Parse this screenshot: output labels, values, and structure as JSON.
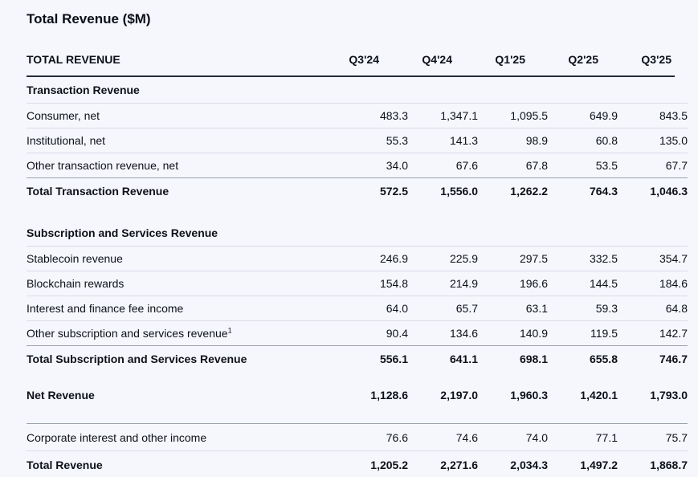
{
  "page": {
    "background_color": "#f5f7fd",
    "text_color": "#0d1117",
    "dark_rule_color": "#262b36",
    "medium_rule_color": "#9aa0ac",
    "light_rule_color": "#d8dce5"
  },
  "title": "Total Revenue ($M)",
  "table": {
    "header": {
      "label": "TOTAL REVENUE",
      "columns": [
        "Q3'24",
        "Q4'24",
        "Q1'25",
        "Q2'25",
        "Q3'25"
      ]
    },
    "rows": [
      {
        "type": "section",
        "label": "Transaction Revenue"
      },
      {
        "type": "data",
        "label": "Consumer, net",
        "values": [
          "483.3",
          "1,347.1",
          "1,095.5",
          "649.9",
          "843.5"
        ]
      },
      {
        "type": "data",
        "label": "Institutional, net",
        "values": [
          "55.3",
          "141.3",
          "98.9",
          "60.8",
          "135.0"
        ]
      },
      {
        "type": "data",
        "label": "Other transaction revenue, net",
        "values": [
          "34.0",
          "67.6",
          "67.8",
          "53.5",
          "67.7"
        ]
      },
      {
        "type": "total",
        "label": "Total Transaction Revenue",
        "values": [
          "572.5",
          "1,556.0",
          "1,262.2",
          "764.3",
          "1,046.3"
        ]
      },
      {
        "type": "section",
        "label": "Subscription and Services Revenue"
      },
      {
        "type": "data",
        "label": "Stablecoin revenue",
        "values": [
          "246.9",
          "225.9",
          "297.5",
          "332.5",
          "354.7"
        ]
      },
      {
        "type": "data",
        "label": "Blockchain rewards",
        "values": [
          "154.8",
          "214.9",
          "196.6",
          "144.5",
          "184.6"
        ]
      },
      {
        "type": "data",
        "label": "Interest and finance fee income",
        "values": [
          "64.0",
          "65.7",
          "63.1",
          "59.3",
          "64.8"
        ]
      },
      {
        "type": "data",
        "label": "Other subscription and services revenue",
        "sup": "1",
        "values": [
          "90.4",
          "134.6",
          "140.9",
          "119.5",
          "142.7"
        ]
      },
      {
        "type": "total",
        "label": "Total Subscription and Services Revenue",
        "values": [
          "556.1",
          "641.1",
          "698.1",
          "655.8",
          "746.7"
        ]
      },
      {
        "type": "total",
        "label": "Net Revenue",
        "values": [
          "1,128.6",
          "2,197.0",
          "1,960.3",
          "1,420.1",
          "1,793.0"
        ]
      },
      {
        "type": "data",
        "label": "Corporate interest and other income",
        "values": [
          "76.6",
          "74.6",
          "74.0",
          "77.1",
          "75.7"
        ]
      },
      {
        "type": "total",
        "label": "Total Revenue",
        "values": [
          "1,205.2",
          "2,271.6",
          "2,034.3",
          "1,497.2",
          "1,868.7"
        ]
      }
    ]
  },
  "chart_data": {
    "type": "table",
    "title": "Total Revenue ($M)",
    "categories": [
      "Q3'24",
      "Q4'24",
      "Q1'25",
      "Q2'25",
      "Q3'25"
    ],
    "series": [
      {
        "name": "Consumer, net",
        "section": "Transaction Revenue",
        "values": [
          483.3,
          1347.1,
          1095.5,
          649.9,
          843.5
        ]
      },
      {
        "name": "Institutional, net",
        "section": "Transaction Revenue",
        "values": [
          55.3,
          141.3,
          98.9,
          60.8,
          135.0
        ]
      },
      {
        "name": "Other transaction revenue, net",
        "section": "Transaction Revenue",
        "values": [
          34.0,
          67.6,
          67.8,
          53.5,
          67.7
        ]
      },
      {
        "name": "Total Transaction Revenue",
        "section": "Transaction Revenue",
        "values": [
          572.5,
          1556.0,
          1262.2,
          764.3,
          1046.3
        ]
      },
      {
        "name": "Stablecoin revenue",
        "section": "Subscription and Services Revenue",
        "values": [
          246.9,
          225.9,
          297.5,
          332.5,
          354.7
        ]
      },
      {
        "name": "Blockchain rewards",
        "section": "Subscription and Services Revenue",
        "values": [
          154.8,
          214.9,
          196.6,
          144.5,
          184.6
        ]
      },
      {
        "name": "Interest and finance fee income",
        "section": "Subscription and Services Revenue",
        "values": [
          64.0,
          65.7,
          63.1,
          59.3,
          64.8
        ]
      },
      {
        "name": "Other subscription and services revenue",
        "section": "Subscription and Services Revenue",
        "values": [
          90.4,
          134.6,
          140.9,
          119.5,
          142.7
        ]
      },
      {
        "name": "Total Subscription and Services Revenue",
        "section": "Subscription and Services Revenue",
        "values": [
          556.1,
          641.1,
          698.1,
          655.8,
          746.7
        ]
      },
      {
        "name": "Net Revenue",
        "values": [
          1128.6,
          2197.0,
          1960.3,
          1420.1,
          1793.0
        ]
      },
      {
        "name": "Corporate interest and other income",
        "values": [
          76.6,
          74.6,
          74.0,
          77.1,
          75.7
        ]
      },
      {
        "name": "Total Revenue",
        "values": [
          1205.2,
          2271.6,
          2034.3,
          1497.2,
          1868.7
        ]
      }
    ]
  }
}
